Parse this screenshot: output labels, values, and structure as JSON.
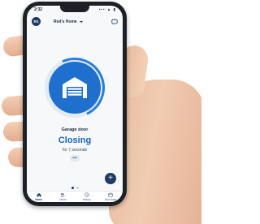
{
  "status_bar": {
    "time": "2:32",
    "icons": "••• ▲ ▮"
  },
  "header": {
    "avatar_initials": "RS",
    "home_name": "Red's Home"
  },
  "device": {
    "name": "Garage door",
    "state": "Closing",
    "duration": "for 7 seconds",
    "more_label": "•••"
  },
  "fab_label": "+",
  "pager": {
    "count": 2,
    "active": 0
  },
  "tabs": [
    {
      "label": "Home",
      "icon": "home-icon"
    },
    {
      "label": "Users",
      "icon": "users-icon"
    },
    {
      "label": "History",
      "icon": "history-icon"
    },
    {
      "label": "Schedules",
      "icon": "calendar-icon"
    }
  ],
  "colors": {
    "primary": "#1f6fcf",
    "navy": "#1f3b63",
    "accent_text": "#1664c8"
  }
}
